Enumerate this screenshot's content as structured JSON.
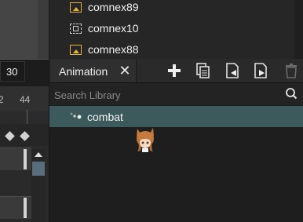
{
  "timeline": {
    "frame_value": "30",
    "ticks": [
      "2",
      "44"
    ]
  },
  "library_top": {
    "items": [
      {
        "label": "comnex89",
        "icon": "image-icon"
      },
      {
        "label": "comnex10",
        "icon": "frame-icon"
      },
      {
        "label": "comnex88",
        "icon": "image-icon"
      }
    ]
  },
  "animation_panel": {
    "tab_label": "Animation",
    "search_placeholder": "Search Library",
    "items": [
      {
        "label": "combat",
        "icon": "animation-icon",
        "selected": true
      }
    ],
    "toolbar": [
      "add-icon",
      "copy-icon",
      "import-icon",
      "export-icon",
      "trash-icon"
    ]
  },
  "colors": {
    "selected_row": "#3c5a5c",
    "accent_icon": "#e3b33b",
    "scroll_thumb": "#5a6d7d"
  }
}
